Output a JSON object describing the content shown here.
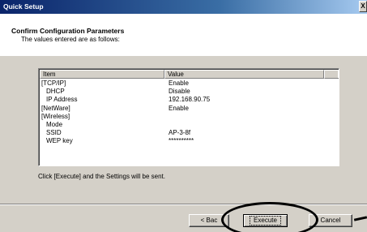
{
  "window": {
    "title": "Quick Setup",
    "close_label": "X"
  },
  "header": {
    "title": "Confirm Configuration Parameters",
    "subtitle": "The values entered are as follows:"
  },
  "table": {
    "columns": {
      "item": "Item",
      "value": "Value"
    },
    "rows": [
      {
        "item": "[TCP/IP]",
        "value": "Enable"
      },
      {
        "item": "DHCP",
        "value": "Disable"
      },
      {
        "item": "IP Address",
        "value": "192.168.90.75"
      },
      {
        "item": "[NetWare]",
        "value": "Enable"
      },
      {
        "item": "[Wireless]",
        "value": ""
      },
      {
        "item": "Mode",
        "value": ""
      },
      {
        "item": "SSID",
        "value": "AP-3-8f"
      },
      {
        "item": "WEP key",
        "value": "**********"
      }
    ]
  },
  "message": "Click [Execute] and the Settings will be sent.",
  "buttons": {
    "back": "< Bac",
    "execute": "Execute",
    "cancel": "Cancel"
  }
}
